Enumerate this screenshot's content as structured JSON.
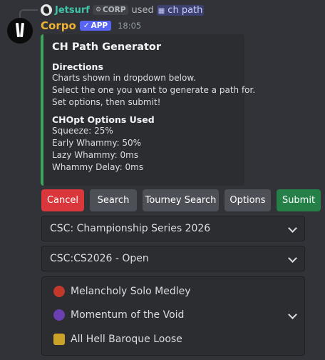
{
  "reply": {
    "user": "Jetsurf",
    "tag": "CORP",
    "used": "used",
    "command": "ch path"
  },
  "message": {
    "author": "Corpo",
    "badge": "APP",
    "time": "18:05"
  },
  "embed": {
    "accent_color": "#3ba55c",
    "title": "CH Path Generator",
    "directions_title": "Directions",
    "directions": [
      "Charts shown in dropdown below.",
      "Select the one you want to generate a path for.",
      "Set options, then submit!"
    ],
    "options_title": "CHOpt Options Used",
    "options": [
      "Squeeze: 25%",
      "Early Whammy: 50%",
      "Lazy Whammy: 0ms",
      "Whammy Delay: 0ms"
    ]
  },
  "buttons": {
    "cancel": "Cancel",
    "search": "Search",
    "tourney_search": "Tourney Search",
    "options": "Options",
    "submit": "Submit"
  },
  "selects": {
    "championship": "CSC: Championship Series 2026",
    "division": "CSC:CS2026 - Open",
    "charts": [
      {
        "label": "Melancholy Solo Medley",
        "icon": "red-skull-icon"
      },
      {
        "label": "Momentum of the Void",
        "icon": "purple-band-icon"
      },
      {
        "label": "All Hell Baroque Loose",
        "icon": "gold-crest-icon"
      }
    ]
  },
  "colors": {
    "background": "#313338",
    "cancel": "#da373c",
    "submit": "#248046",
    "secondary": "#4e5058",
    "author": "#f0b232",
    "reply_user": "#40c4a8",
    "app_badge": "#5865f2"
  }
}
